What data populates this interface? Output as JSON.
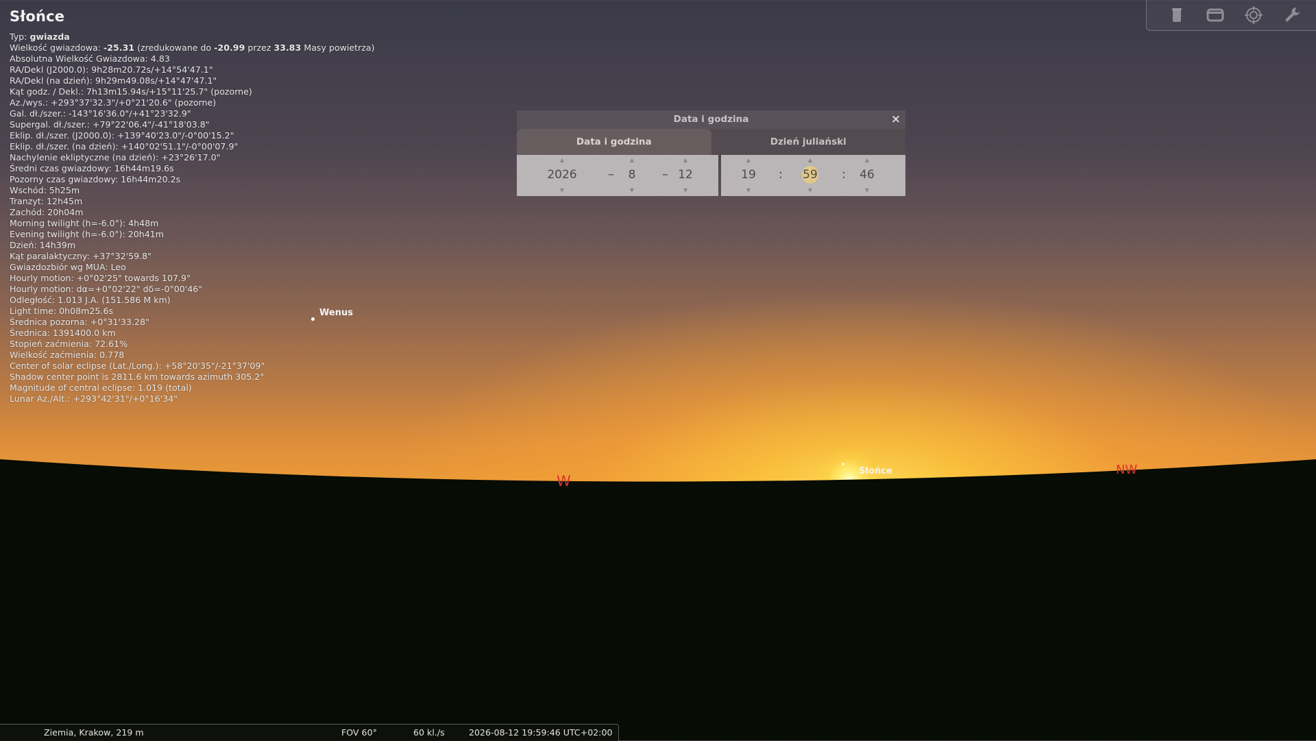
{
  "object": {
    "title": "Słońce",
    "type_label": "Typ: ",
    "type_value": "gwiazda",
    "magnitude": {
      "label": "Wielkość gwiazdowa: ",
      "value": "-25.31",
      "mid": " (zredukowane do ",
      "reduced": "-20.99",
      "mid2": " przez ",
      "airmass": "33.83",
      "tail": " Masy powietrza)"
    },
    "lines": [
      "Absolutna Wielkość Gwiazdowa: 4.83",
      "RA/Dekl (J2000.0): 9h28m20.72s/+14°54'47.1\"",
      "RA/Dekl (na dzień): 9h29m49.08s/+14°47'47.1\"",
      "Kąt godz. / Dekl.: 7h13m15.94s/+15°11'25.7\" (pozorne)",
      "Az./wys.: +293°37'32.3\"/+0°21'20.6\" (pozorne)",
      "Gal. dł./szer.: -143°16'36.0\"/+41°23'32.9\"",
      "Supergal. dł./szer.: +79°22'06.4\"/-41°18'03.8\"",
      "Eklip. dł./szer. (J2000.0): +139°40'23.0\"/-0°00'15.2\"",
      "Eklip. dł./szer. (na dzień): +140°02'51.1\"/-0°00'07.9\"",
      "Nachylenie ekliptyczne (na dzień): +23°26'17.0\"",
      "Średni czas gwiazdowy: 16h44m19.6s",
      "Pozorny czas gwiazdowy: 16h44m20.2s",
      "Wschód: 5h25m",
      "Tranzyt: 12h45m",
      "Zachód: 20h04m",
      "Morning twilight (h=-6.0°): 4h48m",
      "Evening twilight (h=-6.0°): 20h41m",
      "Dzień: 14h39m",
      "Kąt paralaktyczny: +37°32'59.8\"",
      "Gwiazdozbiór wg MUA: Leo",
      "Hourly motion: +0°02'25\" towards 107.9°",
      "Hourly motion: dα=+0°02'22\" dδ=-0°00'46\"",
      "Odległość: 1.013 J.A. (151.586 M km)",
      "Light time: 0h08m25.6s",
      "Średnica pozorna: +0°31'33.28\"",
      "Średnica: 1391400.0 km",
      "Stopień zaćmienia: 72.61%",
      "Wielkość zaćmienia: 0.778",
      "Center of solar eclipse (Lat./Long.): +58°20'35\"/-21°37'09\"",
      "Shadow center point is 2811.6 km towards azimuth 305.2°",
      "Magnitude of central eclipse: 1.019 (total)",
      "Lunar Az./Alt.: +293°42'31\"/+0°16'34\""
    ]
  },
  "sky_labels": {
    "venus": "Wenus",
    "sun": "Słońce",
    "west": "W",
    "northwest": "NW"
  },
  "colors": {
    "cardinal": "#d9302a",
    "ground": "#070c05",
    "highlight": "#f0cd78"
  },
  "toolbar": {
    "icons": [
      "trash-icon",
      "window-icon",
      "target-icon",
      "wrench-icon"
    ]
  },
  "dialog": {
    "title": "Data i godzina",
    "close": "×",
    "tabs": [
      "Data i godzina",
      "Dzień juliański"
    ],
    "date": {
      "year": "2026",
      "month": "8",
      "day": "12",
      "sep": "–"
    },
    "time": {
      "hour": "19",
      "minute": "59",
      "second": "46",
      "sep": ":"
    },
    "arrow_up": "▲",
    "arrow_down": "▼"
  },
  "status": {
    "location": "Ziemia, Krakow, 219 m",
    "fov": "FOV 60°",
    "fps": "60 kl./s",
    "datetime": "2026-08-12 19:59:46 UTC+02:00"
  }
}
